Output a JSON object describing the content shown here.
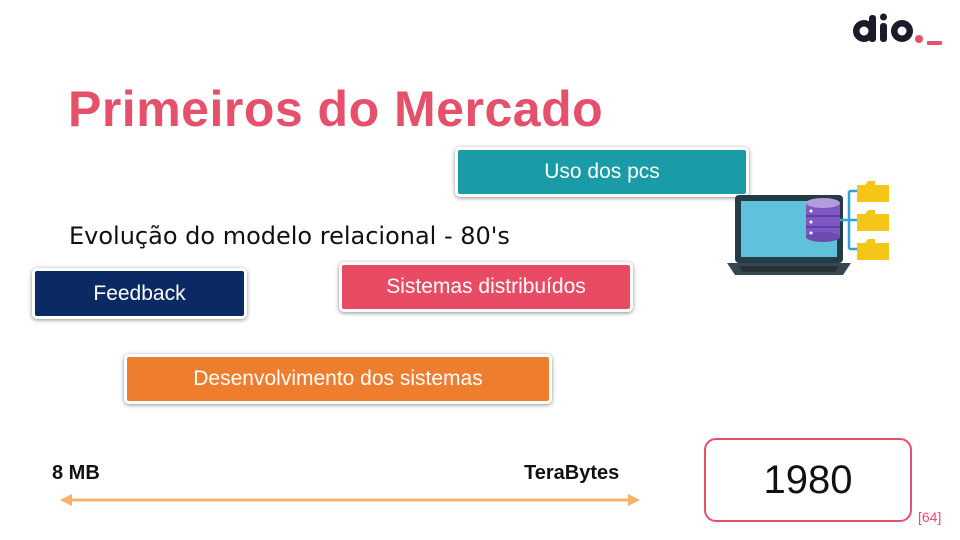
{
  "logo": {
    "icon": "dio-logo-icon",
    "text": "dio._",
    "colors": {
      "dark": "#1b1b29",
      "accent": "#e5506a"
    }
  },
  "title": "Primeiros do Mercado",
  "subtitle": "Evolução do modelo relacional - 80's",
  "boxes": {
    "uso_dos_pcs": "Uso dos pcs",
    "feedback": "Feedback",
    "sistemas_distribuidos": "Sistemas distribuídos",
    "desenvolvimento": "Desenvolvimento dos sistemas"
  },
  "illustration": {
    "icon": "laptop-database-folders-icon"
  },
  "scale": {
    "min_label": "8 MB",
    "max_label": "TeraBytes",
    "arrow_icon": "double-arrow-icon"
  },
  "year": "1980",
  "page_number": "[64]",
  "colors": {
    "title": "#e5506a",
    "teal": "#1a9ba8",
    "navy": "#0b2a63",
    "pink": "#e84b63",
    "orange": "#ef7d2e",
    "arrow": "#f4b266"
  }
}
